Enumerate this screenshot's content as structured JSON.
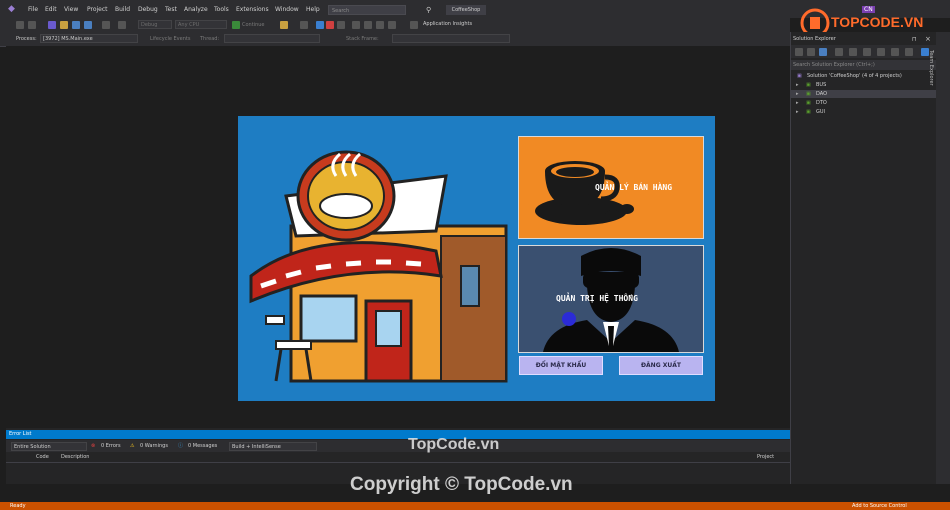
{
  "window": {
    "title_tag": "CoffeeShop",
    "account": "CN"
  },
  "menu": [
    "File",
    "Edit",
    "View",
    "Project",
    "Build",
    "Debug",
    "Test",
    "Analyze",
    "Tools",
    "Extensions",
    "Window",
    "Help"
  ],
  "search_placeholder": "Search",
  "toolbar": {
    "config": "Debug",
    "platform": "Any CPU",
    "continue": "Continue",
    "app_insights": "Application Insights",
    "process_label": "Process:",
    "process_value": "[3972] MS.Main.exe",
    "lifecycle": "Lifecycle Events",
    "thread": "Thread:",
    "stack_frame": "Stack Frame:"
  },
  "form": {
    "sales_button": "QUẢN LÝ BÁN HÀNG",
    "admin_button": "QUẢN TRỊ HỆ THỐNG",
    "change_password_button": "ĐỔI MẬT KHẨU",
    "logout_button": "ĐĂNG XUẤT"
  },
  "solution_explorer": {
    "title": "Solution Explorer",
    "search_placeholder": "Search Solution Explorer (Ctrl+;)",
    "solution_label": "Solution 'CoffeeShop' (4 of 4 projects)",
    "projects": [
      "BUS",
      "DAO",
      "DTO",
      "GUI"
    ],
    "side_tab": "Team Explorer"
  },
  "error_list": {
    "title": "Error List",
    "scope": "Entire Solution",
    "errors": "0 Errors",
    "warnings": "0 Warnings",
    "messages": "0 Messages",
    "build_filter": "Build + IntelliSense",
    "col_code": "Code",
    "col_description": "Description",
    "col_project": "Project"
  },
  "status": {
    "left": "Ready",
    "right": "Add to Source Control"
  },
  "watermark": {
    "site": "TopCode.vn",
    "copyright": "Copyright © TopCode.vn",
    "logo": "TOPCODE.VN"
  },
  "colors": {
    "accent": "#007acc",
    "status": "#ca5100",
    "form_bg": "#1e7dc3",
    "sales_btn": "#f18a24",
    "admin_btn": "#3a5070",
    "small_btn": "#b9b4f0"
  }
}
